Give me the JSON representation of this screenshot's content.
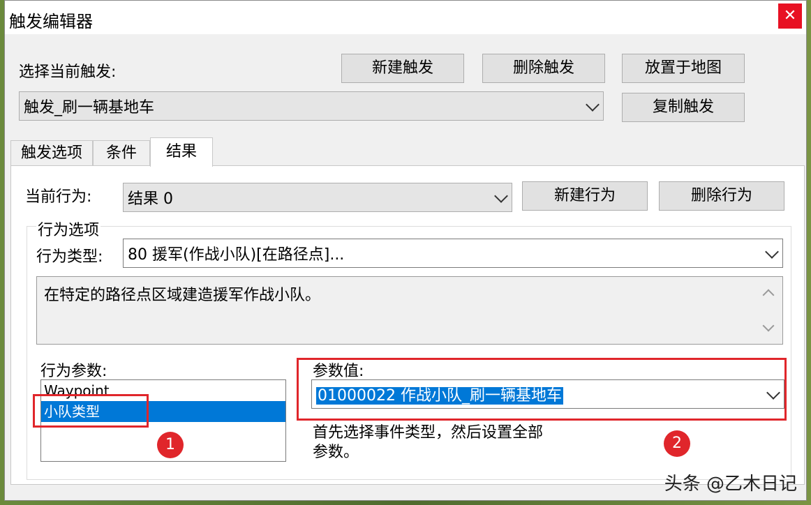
{
  "window": {
    "title": "触发编辑器",
    "close_glyph": "✕"
  },
  "trigger": {
    "select_label": "选择当前触发:",
    "current": "触发_刷一辆基地车",
    "buttons": {
      "new": "新建触发",
      "delete": "删除触发",
      "place": "放置于地图",
      "copy": "复制触发"
    }
  },
  "tabs": [
    {
      "label": "触发选项"
    },
    {
      "label": "条件"
    },
    {
      "label": "结果",
      "active": true
    }
  ],
  "result": {
    "current_action_label": "当前行为:",
    "current_action": "结果 0",
    "new_action": "新建行为",
    "delete_action": "删除行为",
    "options_group": "行为选项",
    "action_type_label": "行为类型:",
    "action_type": "80 援军(作战小队)[在路径点]...",
    "description": "在特定的路径点区域建造援军作战小队。",
    "params_label": "行为参数:",
    "params": [
      {
        "label": "Waypoint",
        "selected": false
      },
      {
        "label": "小队类型",
        "selected": true
      }
    ],
    "param_value_label": "参数值:",
    "param_value": "01000022 作战小队_刷一辆基地车",
    "hint_line1": "首先选择事件类型，然后设置全部",
    "hint_line2": "参数。"
  },
  "annotations": {
    "marker1": "1",
    "marker2": "2",
    "accent": "#e0262b"
  },
  "watermark": "头条 @乙木日记"
}
